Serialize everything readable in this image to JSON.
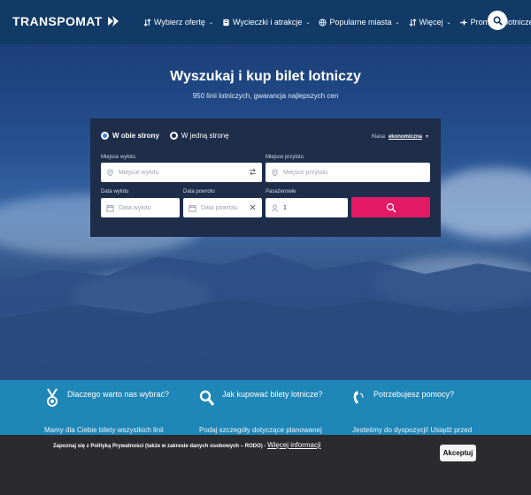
{
  "header": {
    "logo_text": "TRANSPOMAT",
    "nav": [
      {
        "label": "Wybierz ofertę",
        "icon": "sort-icon",
        "caret": "⌄"
      },
      {
        "label": "Wycieczki i atrakcje",
        "icon": "book-icon",
        "caret": "⌄"
      },
      {
        "label": "Popularne miasta",
        "icon": "globe-icon",
        "caret": "⌄"
      },
      {
        "label": "Więcej",
        "icon": "sort-icon",
        "caret": "⌄"
      },
      {
        "label": "Promocje lotnicze",
        "icon": "plane-icon",
        "caret": ""
      }
    ]
  },
  "hero": {
    "title": "Wyszukaj i kup bilet lotniczy",
    "subtitle": "950 linii lotniczych, gwarancja najlepszych cen"
  },
  "search": {
    "trip_round": "W obie strony",
    "trip_oneway": "W jedną stronę",
    "class_label": "Klasa",
    "class_value": "ekonomiczna",
    "from_label": "Miejsce wylotu",
    "from_placeholder": "Miejsce wylotu",
    "to_label": "Miejsce przylotu",
    "to_placeholder": "Miejsce przylotu",
    "depart_label": "Data wylotu",
    "depart_placeholder": "Data wylotu",
    "return_label": "Data powrotu",
    "return_placeholder": "Data powrotu",
    "pax_label": "Pasażerowie",
    "pax_value": "1"
  },
  "info": [
    {
      "title": "Dlaczego warto nas wybrać?",
      "text": "Mamy dla Ciebie bilety wszystkich linii",
      "icon": "medal-icon"
    },
    {
      "title": "Jak kupować bilety lotnicze?",
      "text": "Podaj szczegóły dotyczące planowanej",
      "icon": "search-icon"
    },
    {
      "title": "Potrzebujesz pomocy?",
      "text": "Jesteśmy do dyspozycji! Usiądź przed",
      "icon": "phone-icon"
    }
  ],
  "cookie": {
    "text": "Zapoznaj się z Polityką Prywatności (także w zakresie danych osobowych – RODO) -",
    "link": "Więcej informacji",
    "accept": "Akceptuj"
  },
  "colors": {
    "header_bg": "#123a66",
    "accent_pink": "#e11a63",
    "info_bg": "#1f86b8",
    "cookie_bg": "#2b2b2f",
    "panel_bg": "#1e2d4a"
  }
}
